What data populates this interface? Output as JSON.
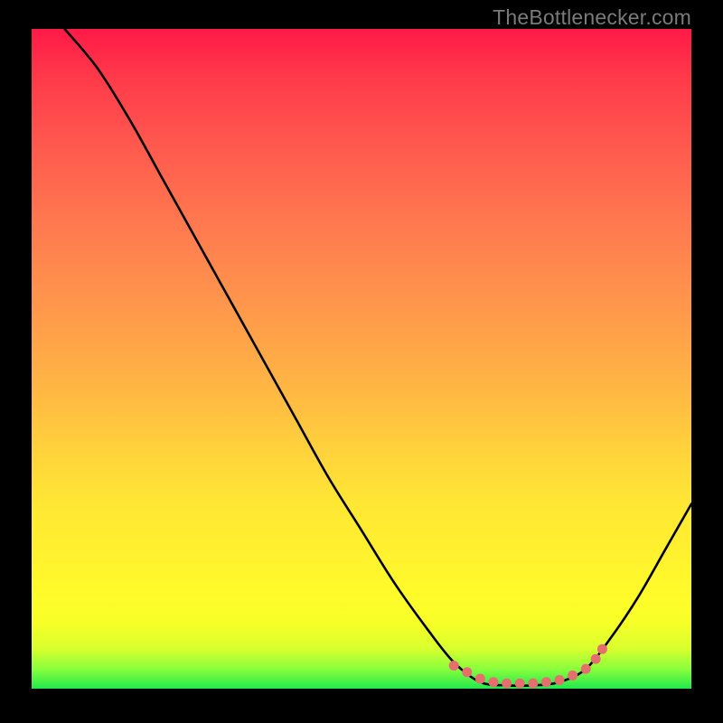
{
  "attribution": "TheBottlenecker.com",
  "chart_data": {
    "type": "line",
    "title": "",
    "xlabel": "",
    "ylabel": "",
    "xlim": [
      0,
      100
    ],
    "ylim": [
      0,
      100
    ],
    "curve": [
      {
        "x": 5,
        "y": 100
      },
      {
        "x": 10,
        "y": 94
      },
      {
        "x": 15,
        "y": 86
      },
      {
        "x": 20,
        "y": 77
      },
      {
        "x": 25,
        "y": 68
      },
      {
        "x": 30,
        "y": 59
      },
      {
        "x": 35,
        "y": 50
      },
      {
        "x": 40,
        "y": 41
      },
      {
        "x": 45,
        "y": 32
      },
      {
        "x": 50,
        "y": 24
      },
      {
        "x": 55,
        "y": 16
      },
      {
        "x": 60,
        "y": 9
      },
      {
        "x": 64,
        "y": 4
      },
      {
        "x": 68,
        "y": 1
      },
      {
        "x": 72,
        "y": 0.5
      },
      {
        "x": 76,
        "y": 0.5
      },
      {
        "x": 80,
        "y": 1
      },
      {
        "x": 84,
        "y": 3
      },
      {
        "x": 88,
        "y": 8
      },
      {
        "x": 92,
        "y": 14
      },
      {
        "x": 96,
        "y": 21
      },
      {
        "x": 100,
        "y": 28
      }
    ],
    "markers": [
      {
        "x": 64,
        "y": 3.5
      },
      {
        "x": 66,
        "y": 2.5
      },
      {
        "x": 68,
        "y": 1.5
      },
      {
        "x": 70,
        "y": 1.0
      },
      {
        "x": 72,
        "y": 0.8
      },
      {
        "x": 74,
        "y": 0.8
      },
      {
        "x": 76,
        "y": 0.8
      },
      {
        "x": 78,
        "y": 1.0
      },
      {
        "x": 80,
        "y": 1.3
      },
      {
        "x": 82,
        "y": 2.0
      },
      {
        "x": 84,
        "y": 3.0
      },
      {
        "x": 85.5,
        "y": 4.5
      },
      {
        "x": 86.5,
        "y": 6.0
      }
    ],
    "curve_color": "#000000",
    "marker_color": "#e76e6e"
  }
}
